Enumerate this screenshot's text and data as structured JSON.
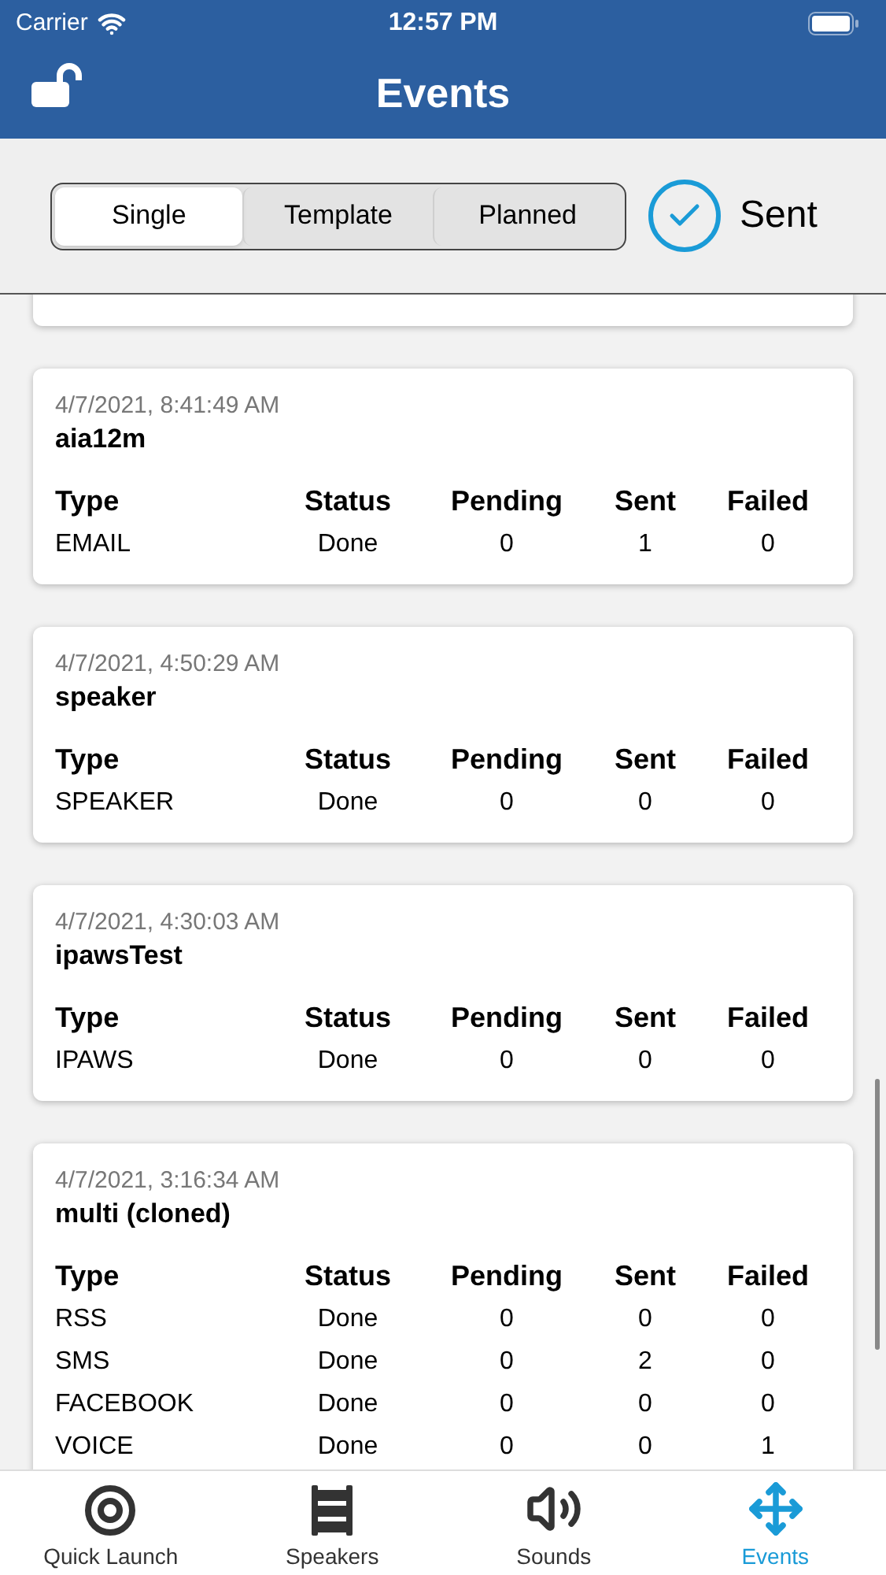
{
  "status_bar": {
    "carrier": "Carrier",
    "time": "12:57 PM"
  },
  "nav": {
    "title": "Events"
  },
  "segments": [
    {
      "label": "Single",
      "selected": true
    },
    {
      "label": "Template",
      "selected": false
    },
    {
      "label": "Planned",
      "selected": false
    }
  ],
  "sent_filter": {
    "label": "Sent",
    "checked": true
  },
  "events": [
    {
      "date": "4/7/2021, 8:41:49 AM",
      "name": "aia12m",
      "columns": [
        "Type",
        "Status",
        "Pending",
        "Sent",
        "Failed"
      ],
      "rows": [
        [
          "EMAIL",
          "Done",
          "0",
          "1",
          "0"
        ]
      ]
    },
    {
      "date": "4/7/2021, 4:50:29 AM",
      "name": "speaker",
      "columns": [
        "Type",
        "Status",
        "Pending",
        "Sent",
        "Failed"
      ],
      "rows": [
        [
          "SPEAKER",
          "Done",
          "0",
          "0",
          "0"
        ]
      ]
    },
    {
      "date": "4/7/2021, 4:30:03 AM",
      "name": "ipawsTest",
      "columns": [
        "Type",
        "Status",
        "Pending",
        "Sent",
        "Failed"
      ],
      "rows": [
        [
          "IPAWS",
          "Done",
          "0",
          "0",
          "0"
        ]
      ]
    },
    {
      "date": "4/7/2021, 3:16:34 AM",
      "name": "multi (cloned)",
      "columns": [
        "Type",
        "Status",
        "Pending",
        "Sent",
        "Failed"
      ],
      "rows": [
        [
          "RSS",
          "Done",
          "0",
          "0",
          "0"
        ],
        [
          "SMS",
          "Done",
          "0",
          "2",
          "0"
        ],
        [
          "FACEBOOK",
          "Done",
          "0",
          "0",
          "0"
        ],
        [
          "VOICE",
          "Done",
          "0",
          "0",
          "1"
        ]
      ]
    }
  ],
  "tabs": [
    {
      "kind": "target",
      "label": "Quick Launch",
      "selected": false
    },
    {
      "kind": "speakers",
      "label": "Speakers",
      "selected": false
    },
    {
      "kind": "sound",
      "label": "Sounds",
      "selected": false
    },
    {
      "kind": "move",
      "label": "Events",
      "selected": true
    }
  ]
}
